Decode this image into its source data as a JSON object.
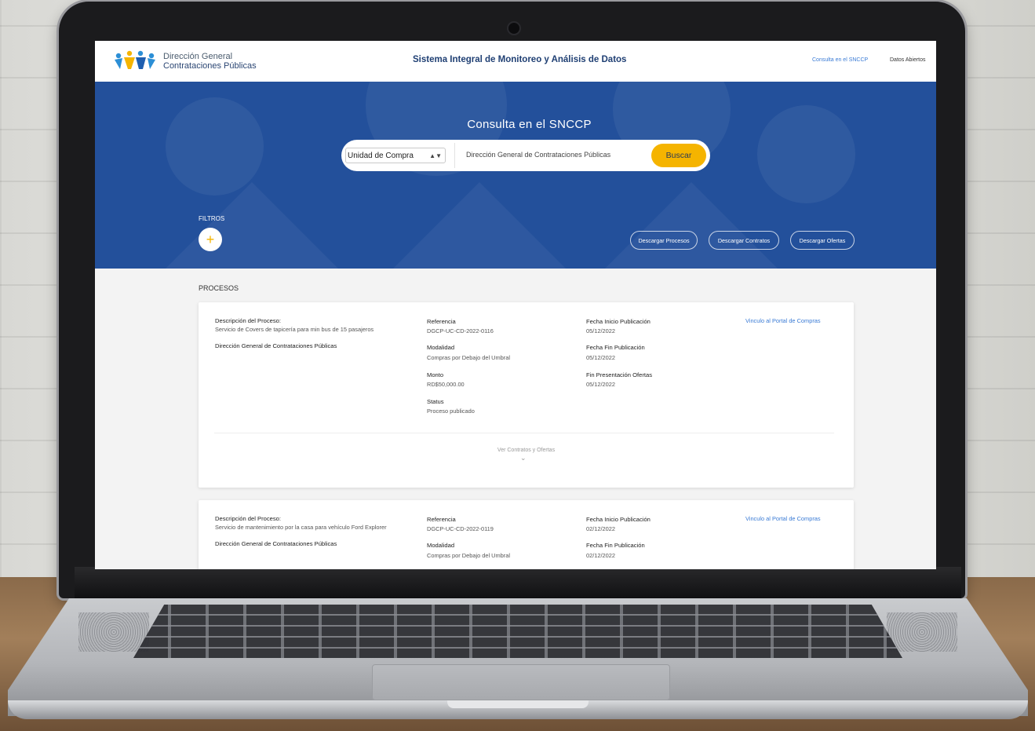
{
  "header": {
    "logo_line1": "Dirección General",
    "logo_line2": "Contrataciones Públicas",
    "app_title": "Sistema Integral de Monitoreo y Análisis de Datos",
    "nav": [
      "Consulta en el SNCCP",
      "Datos Abiertos"
    ]
  },
  "hero": {
    "title": "Consulta en el SNCCP",
    "search_type": "Unidad de Compra",
    "search_value": "Dirección General de Contrataciones Públicas",
    "search_button": "Buscar",
    "filters_label": "FILTROS",
    "download_buttons": [
      "Descargar Procesos",
      "Descargar Contratos",
      "Descargar Ofertas"
    ]
  },
  "processes": {
    "section_title": "PROCESOS",
    "labels": {
      "description": "Descripción del Proceso:",
      "reference": "Referencia",
      "modality": "Modalidad",
      "amount": "Monto",
      "status": "Status",
      "start_pub": "Fecha Inicio Publicación",
      "end_pub": "Fecha Fin Publicación",
      "offers_end": "Fin Presentación Ofertas",
      "portal_link": "Vinculo al Portal de Compras",
      "expand": "Ver Contratos y Ofertas"
    },
    "items": [
      {
        "description": "Servicio de Covers de tapicería para min bus de 15 pasajeros",
        "entity": "Dirección General de Contrataciones Públicas",
        "reference": "DGCP-UC-CD-2022-0116",
        "modality": "Compras por Debajo del Umbral",
        "amount": "RD$50,000.00",
        "status": "Proceso publicado",
        "start_pub": "05/12/2022",
        "end_pub": "05/12/2022",
        "offers_end": "05/12/2022"
      },
      {
        "description": "Servicio de mantenimiento por la casa para vehículo Ford Explorer",
        "entity": "Dirección General de Contrataciones Públicas",
        "reference": "DGCP-UC-CD-2022-0119",
        "modality": "Compras por Debajo del Umbral",
        "start_pub": "02/12/2022",
        "end_pub": "02/12/2022"
      }
    ]
  },
  "colors": {
    "hero_blue": "#23509b",
    "accent_yellow": "#f5b400",
    "link_blue": "#3a7bd5",
    "title_navy": "#1f3f73"
  }
}
